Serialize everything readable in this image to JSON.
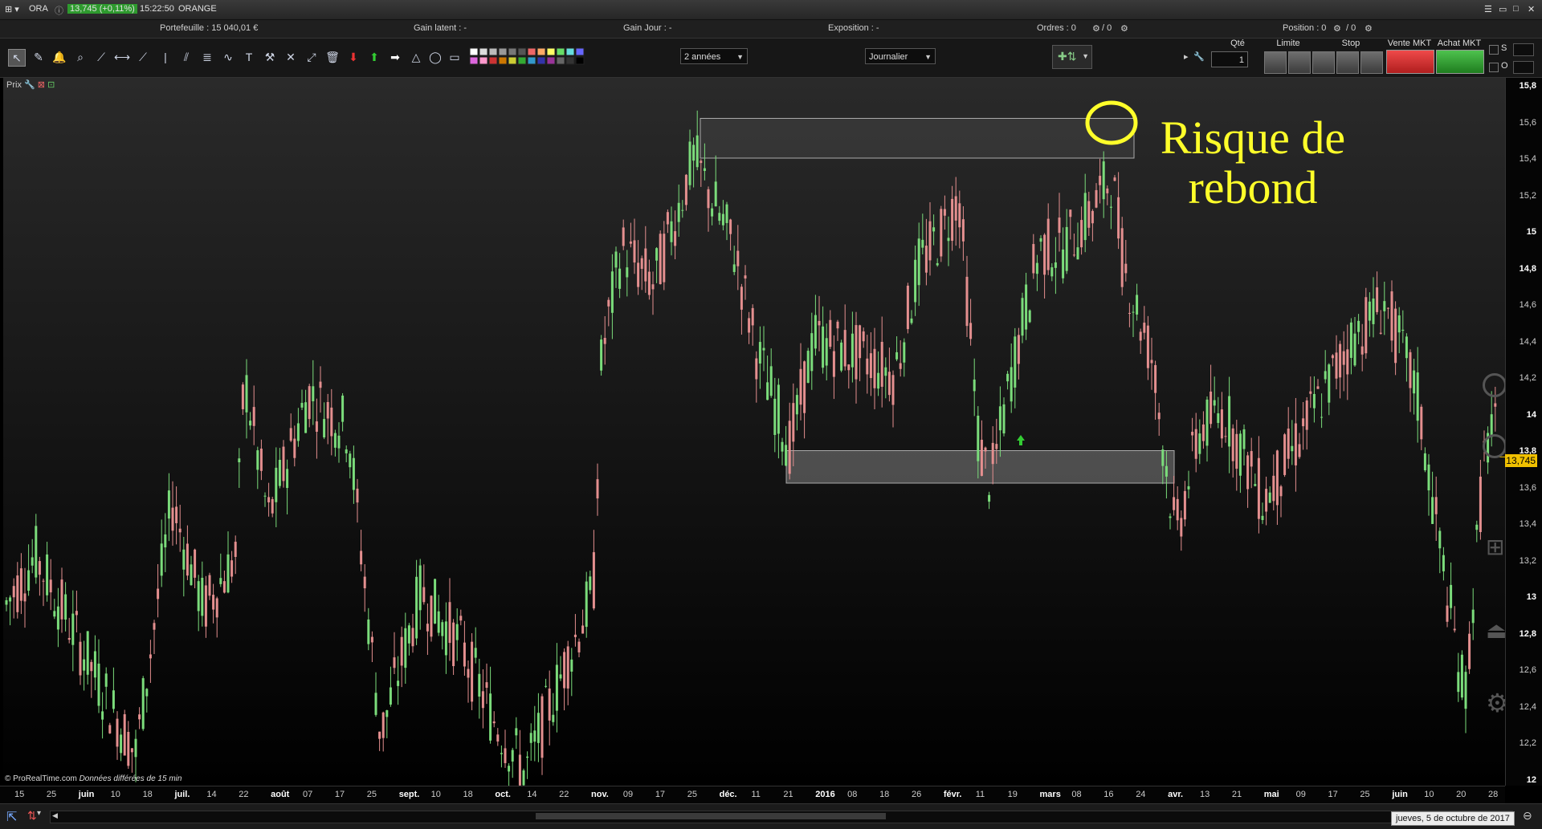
{
  "topbar": {
    "symbol": "ORA",
    "price_badge": "13,745 (+0,11%)",
    "time": "15:22:50",
    "name": "ORANGE"
  },
  "stats": {
    "portefeuille": "Portefeuille : 15 040,01 €",
    "gain_latent": "Gain latent : -",
    "gain_jour": "Gain Jour : -",
    "exposition": "Exposition : -",
    "ordres": "Ordres : 0",
    "ordres2": "/ 0",
    "position": "Position : 0",
    "position2": "/ 0"
  },
  "toolbar": {
    "period": "2 années",
    "interval": "Journalier"
  },
  "trade": {
    "qte_label": "Qté",
    "qte_value": "1",
    "limite_label": "Limite",
    "stop_label": "Stop",
    "vente_label": "Vente MKT",
    "achat_label": "Achat MKT",
    "s_label": "S",
    "o_label": "O"
  },
  "chart": {
    "panel_label": "Prix",
    "current_price": "13,745",
    "watermark": "© ProRealTime.com",
    "watermark2": "Données différées de 15 min",
    "annotation": "Risque de rebond",
    "y_ticks": [
      "15,8",
      "15,6",
      "15,4",
      "15,2",
      "15",
      "14,8",
      "14,6",
      "14,4",
      "14,2",
      "14",
      "13,8",
      "13,6",
      "13,4",
      "13,2",
      "13",
      "12,8",
      "12,6",
      "12,4",
      "12,2",
      "12"
    ],
    "x_ticks": [
      "15",
      "25",
      "juin",
      "10",
      "18",
      "juil.",
      "14",
      "22",
      "août",
      "07",
      "17",
      "25",
      "sept.",
      "10",
      "18",
      "oct.",
      "14",
      "22",
      "nov.",
      "09",
      "17",
      "25",
      "déc.",
      "11",
      "21",
      "2016",
      "08",
      "18",
      "26",
      "févr.",
      "11",
      "19",
      "mars",
      "08",
      "16",
      "24",
      "avr.",
      "13",
      "21",
      "mai",
      "09",
      "17",
      "25",
      "juin",
      "10",
      "20",
      "28"
    ]
  },
  "chart_data": {
    "type": "candlestick",
    "ylim": [
      12,
      15.8
    ],
    "colors": {
      "up": "#7bdc7b",
      "down": "#e48f8f"
    },
    "resistance_zone": [
      15.4,
      15.62
    ],
    "support_zone": [
      13.6,
      13.78
    ]
  },
  "footer": {
    "date": "jueves, 5 de octubre de 2017"
  },
  "colors": {
    "accent_green": "#2e9a2e",
    "annotation_yellow": "#ffff2a",
    "sell_red": "#d93030",
    "buy_green": "#2f9f2f"
  }
}
